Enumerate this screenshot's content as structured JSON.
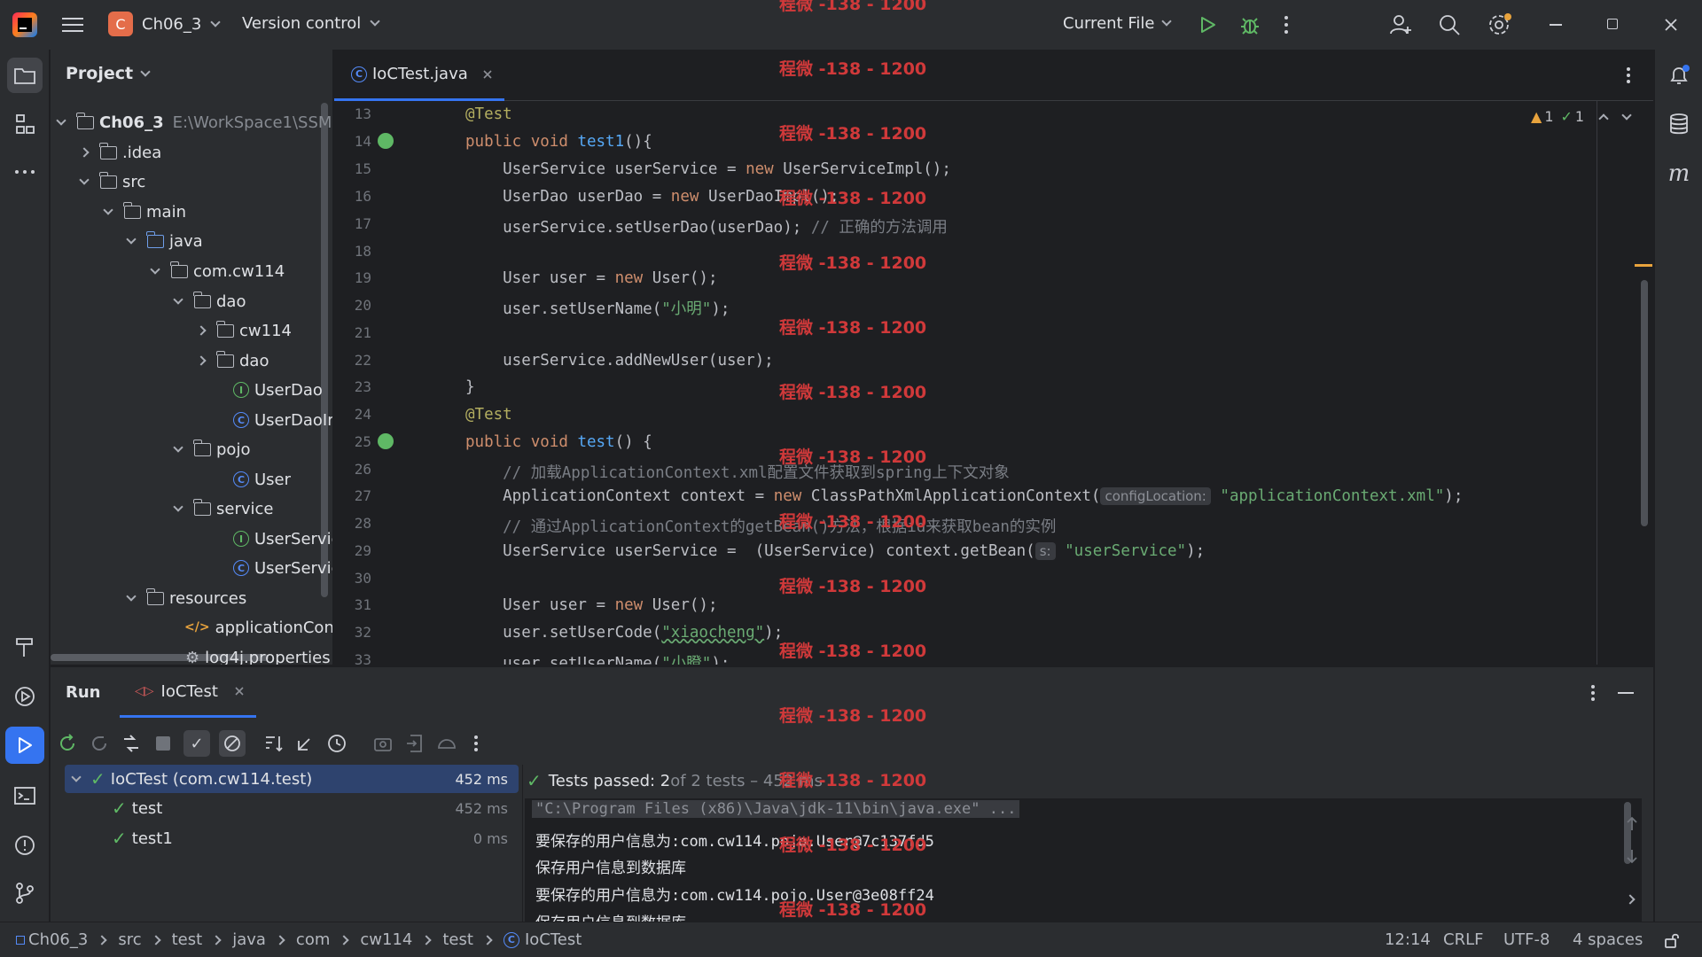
{
  "titlebar": {
    "project_badge": "C",
    "project_name": "Ch06_3",
    "version_control": "Version control",
    "run_config": "Current File"
  },
  "project_panel": {
    "title": "Project",
    "items": [
      {
        "label": "Ch06_3",
        "suffix": "E:\\WorkSpace1\\SSM"
      },
      {
        "label": ".idea"
      },
      {
        "label": "src"
      },
      {
        "label": "main"
      },
      {
        "label": "java"
      },
      {
        "label": "com.cw114"
      },
      {
        "label": "dao"
      },
      {
        "label": "cw114"
      },
      {
        "label": "dao"
      },
      {
        "label": "UserDao",
        "badge": "I"
      },
      {
        "label": "UserDaoIm",
        "badge": "C"
      },
      {
        "label": "pojo"
      },
      {
        "label": "User",
        "badge": "C"
      },
      {
        "label": "service"
      },
      {
        "label": "UserServic",
        "badge": "I"
      },
      {
        "label": "UserServic",
        "badge": "C"
      },
      {
        "label": "resources"
      },
      {
        "label": "applicationConte"
      },
      {
        "label": "log4j.properties"
      }
    ]
  },
  "editor": {
    "tab_label": "IoCTest.java",
    "inspection_warnings": "1",
    "inspection_ok": "1",
    "line_numbers": [
      "13",
      "14",
      "15",
      "16",
      "17",
      "18",
      "19",
      "20",
      "21",
      "22",
      "23",
      "24",
      "25",
      "26",
      "27",
      "28",
      "29",
      "30",
      "31",
      "32",
      "33"
    ],
    "code": {
      "l13": "@Test",
      "l14_kw": "public void ",
      "l14_fn": "test1",
      "l14_rest": "(){",
      "l15_a": "    UserService userService = ",
      "l15_kw": "new",
      "l15_b": " UserServiceImpl();",
      "l16_a": "    UserDao userDao = ",
      "l16_kw": "new",
      "l16_b": " UserDaoImpl();",
      "l17_a": "    userService.setUserDao(userDao); ",
      "l17_cmt": "// 正确的方法调用",
      "l19_a": "    User user = ",
      "l19_kw": "new",
      "l19_b": " User();",
      "l20_a": "    user.setUserName(",
      "l20_str": "\"小明\"",
      "l20_b": ");",
      "l22": "    userService.addNewUser(user);",
      "l23": "}",
      "l24": "@Test",
      "l25_kw": "public void ",
      "l25_fn": "test",
      "l25_rest": "() {",
      "l26_cmt": "    // 加载ApplicationContext.xml配置文件获取到spring上下文对象",
      "l27_a": "    ApplicationContext context = ",
      "l27_kw": "new",
      "l27_b": " ClassPathXmlApplicationContext(",
      "l27_hint": "configLocation:",
      "l27_str": "\"applicationContext.xml\"",
      "l27_c": ");",
      "l28_cmt": "    // 通过ApplicationContext的getBean()方法，根据id来获取bean的实例",
      "l29_a": "    UserService userService =  (UserService) context.getBean(",
      "l29_hint": "s:",
      "l29_str": "\"userService\"",
      "l29_c": ");",
      "l31_a": "    User user = ",
      "l31_kw": "new",
      "l31_b": " User();",
      "l32_a": "    user.setUserCode(",
      "l32_str": "\"xiaocheng\"",
      "l32_b": ");",
      "l33_a": "    user.setUserName(",
      "l33_str": "\"小瞪\"",
      "l33_b": ");"
    }
  },
  "run_panel": {
    "title": "Run",
    "tab_label": "IoCTest",
    "tree": [
      {
        "label": "IoCTest (com.cw114.test)",
        "time": "452 ms"
      },
      {
        "label": "test",
        "time": "452 ms"
      },
      {
        "label": "test1",
        "time": "0 ms"
      }
    ],
    "summary_bold": "Tests passed: 2",
    "summary_rest": " of 2 tests – 452 ms",
    "console_lines": [
      "\"C:\\Program Files (x86)\\Java\\jdk-11\\bin\\java.exe\" ...",
      "要保存的用户信息为:com.cw114.pojo.User@7c137fd5",
      "保存用户信息到数据库",
      "要保存的用户信息为:com.cw114.pojo.User@3e08ff24",
      "保存用户信息到数据库"
    ]
  },
  "statusbar": {
    "breadcrumbs": [
      "Ch06_3",
      "src",
      "test",
      "java",
      "com",
      "cw114",
      "test",
      "IoCTest"
    ],
    "position": "12:14",
    "line_ending": "CRLF",
    "encoding": "UTF-8",
    "indent": "4 spaces"
  },
  "watermark": "程微 -138 - 1200",
  "colors": {
    "accent": "#3574f0",
    "watermark": "#d0393a",
    "pass": "#5fb865",
    "run_green": "#5fb865"
  }
}
